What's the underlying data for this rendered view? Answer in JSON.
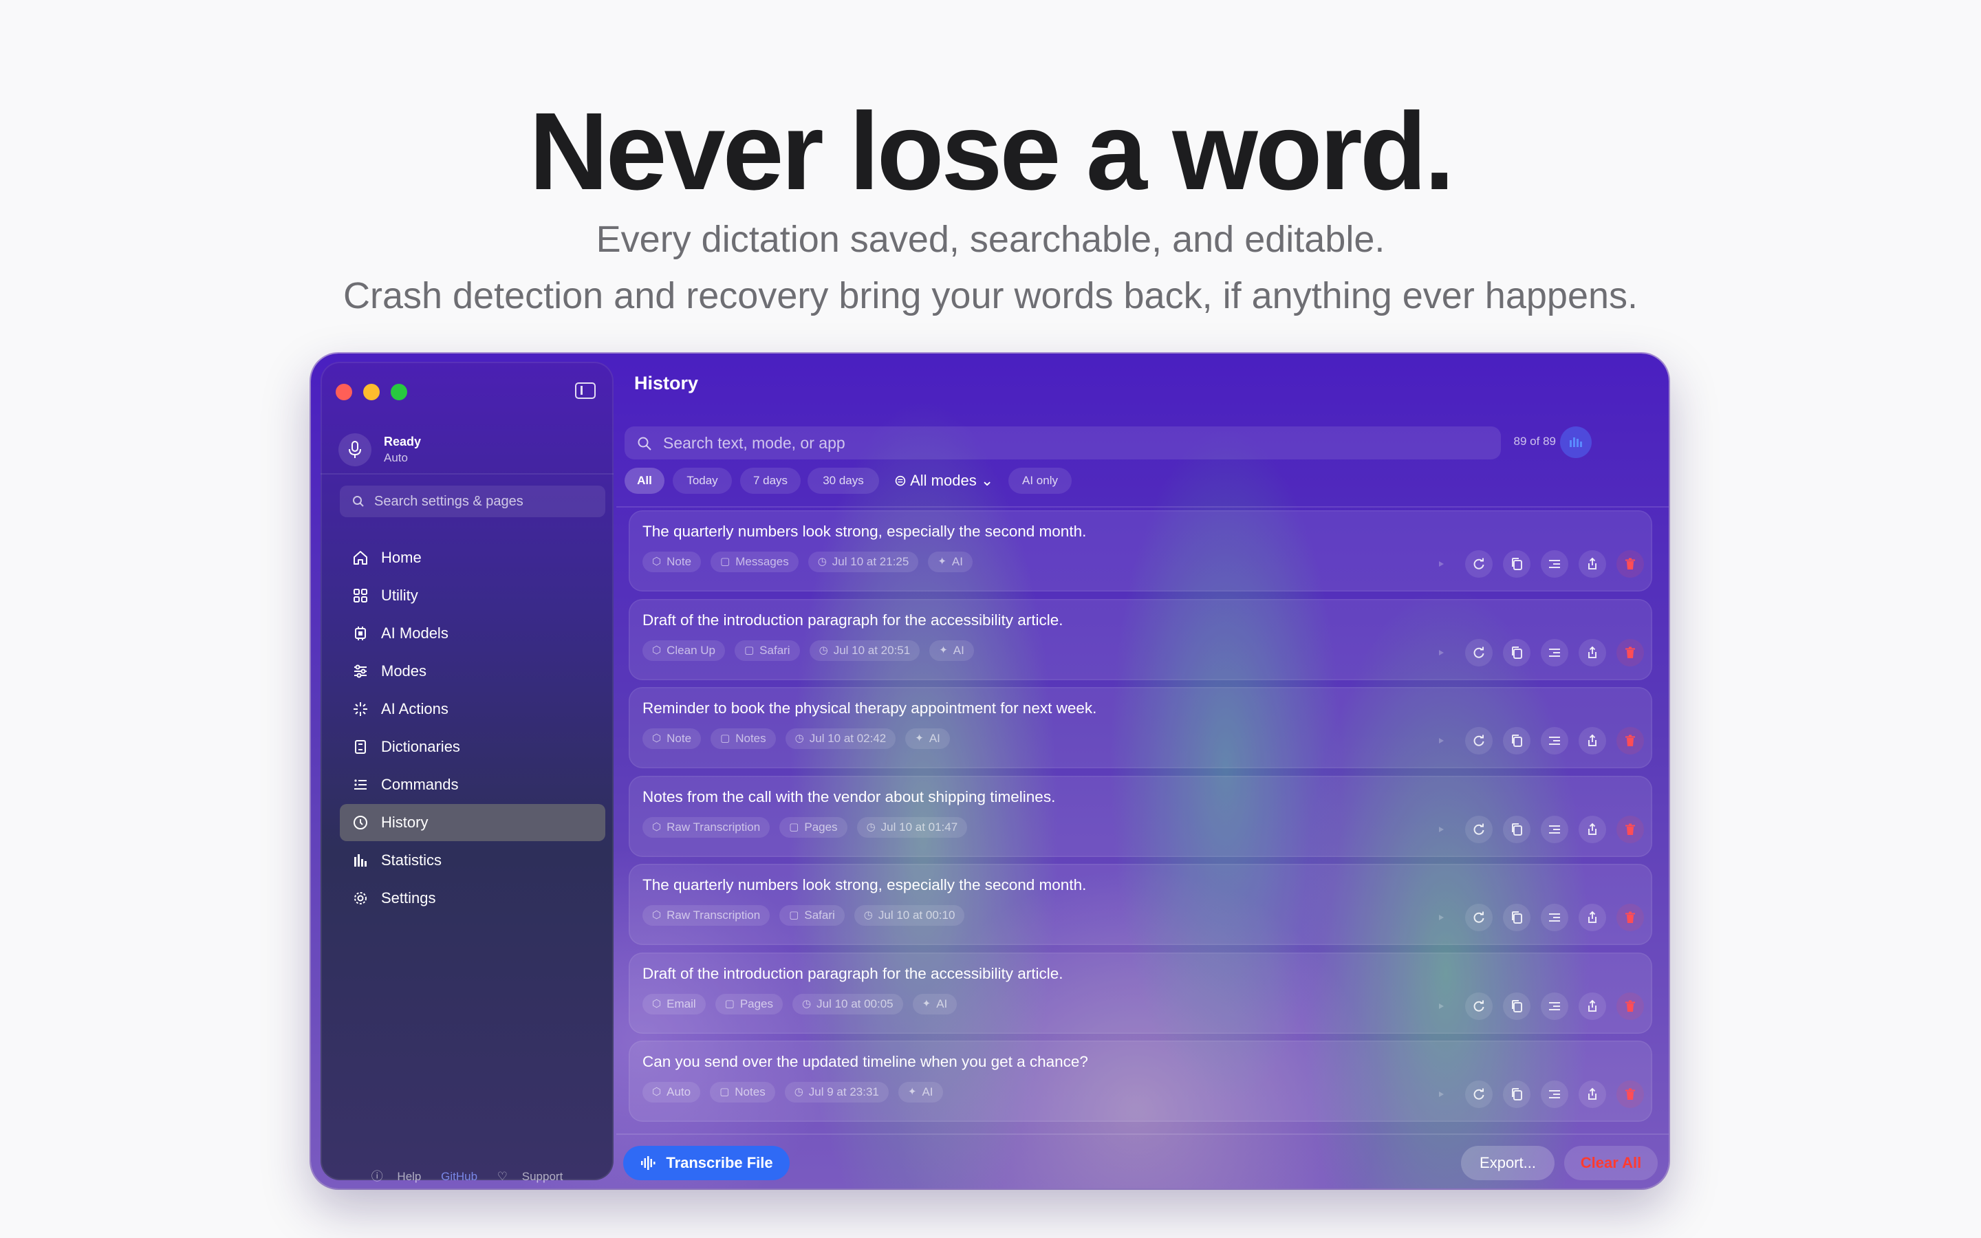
{
  "hero": {
    "title": "Never lose a word.",
    "subtitle1": "Every dictation saved, searchable, and editable.",
    "subtitle2": "Crash detection and recovery bring your words back, if anything ever happens."
  },
  "sidebar": {
    "status_title": "Ready",
    "status_mode": "Auto",
    "search_placeholder": "Search settings & pages",
    "items": [
      {
        "label": "Home",
        "icon": "home-icon"
      },
      {
        "label": "Utility",
        "icon": "grid-icon"
      },
      {
        "label": "AI Models",
        "icon": "chip-icon"
      },
      {
        "label": "Modes",
        "icon": "sliders-icon"
      },
      {
        "label": "AI Actions",
        "icon": "sparkle-icon"
      },
      {
        "label": "Dictionaries",
        "icon": "book-icon"
      },
      {
        "label": "Commands",
        "icon": "list-icon"
      },
      {
        "label": "History",
        "icon": "clock-icon",
        "active": true
      },
      {
        "label": "Statistics",
        "icon": "bar-chart-icon"
      },
      {
        "label": "Settings",
        "icon": "gear-icon"
      }
    ],
    "footer": {
      "help": "Help",
      "github": "GitHub",
      "support": "Support"
    }
  },
  "main": {
    "title": "History",
    "search_placeholder": "Search text, mode, or app",
    "count": "89 of 89",
    "filters": [
      "All",
      "Today",
      "7 days",
      "30 days"
    ],
    "modes_label": "All modes",
    "ai_only": "AI only",
    "entries": [
      {
        "text": "The quarterly numbers look strong, especially the second month.",
        "mode": "Note",
        "app": "Messages",
        "time": "Jul 10 at 21:25",
        "ai": "AI"
      },
      {
        "text": "Draft of the introduction paragraph for the accessibility article.",
        "mode": "Clean Up",
        "app": "Safari",
        "time": "Jul 10 at 20:51",
        "ai": "AI"
      },
      {
        "text": "Reminder to book the physical therapy appointment for next week.",
        "mode": "Note",
        "app": "Notes",
        "time": "Jul 10 at 02:42",
        "ai": "AI"
      },
      {
        "text": "Notes from the call with the vendor about shipping timelines.",
        "mode": "Raw Transcription",
        "app": "Pages",
        "time": "Jul 10 at 01:47",
        "ai": ""
      },
      {
        "text": "The quarterly numbers look strong, especially the second month.",
        "mode": "Raw Transcription",
        "app": "Safari",
        "time": "Jul 10 at 00:10",
        "ai": ""
      },
      {
        "text": "Draft of the introduction paragraph for the accessibility article.",
        "mode": "Email",
        "app": "Pages",
        "time": "Jul 10 at 00:05",
        "ai": "AI"
      },
      {
        "text": "Can you send over the updated timeline when you get a chance?",
        "mode": "Auto",
        "app": "Notes",
        "time": "Jul 9 at 23:31",
        "ai": "AI"
      }
    ],
    "transcribe_label": "Transcribe File",
    "export_label": "Export...",
    "clear_label": "Clear All"
  },
  "colors": {
    "accent": "#2f6af5",
    "danger": "#ff3b30",
    "window_purple": "#4a1fc0"
  }
}
